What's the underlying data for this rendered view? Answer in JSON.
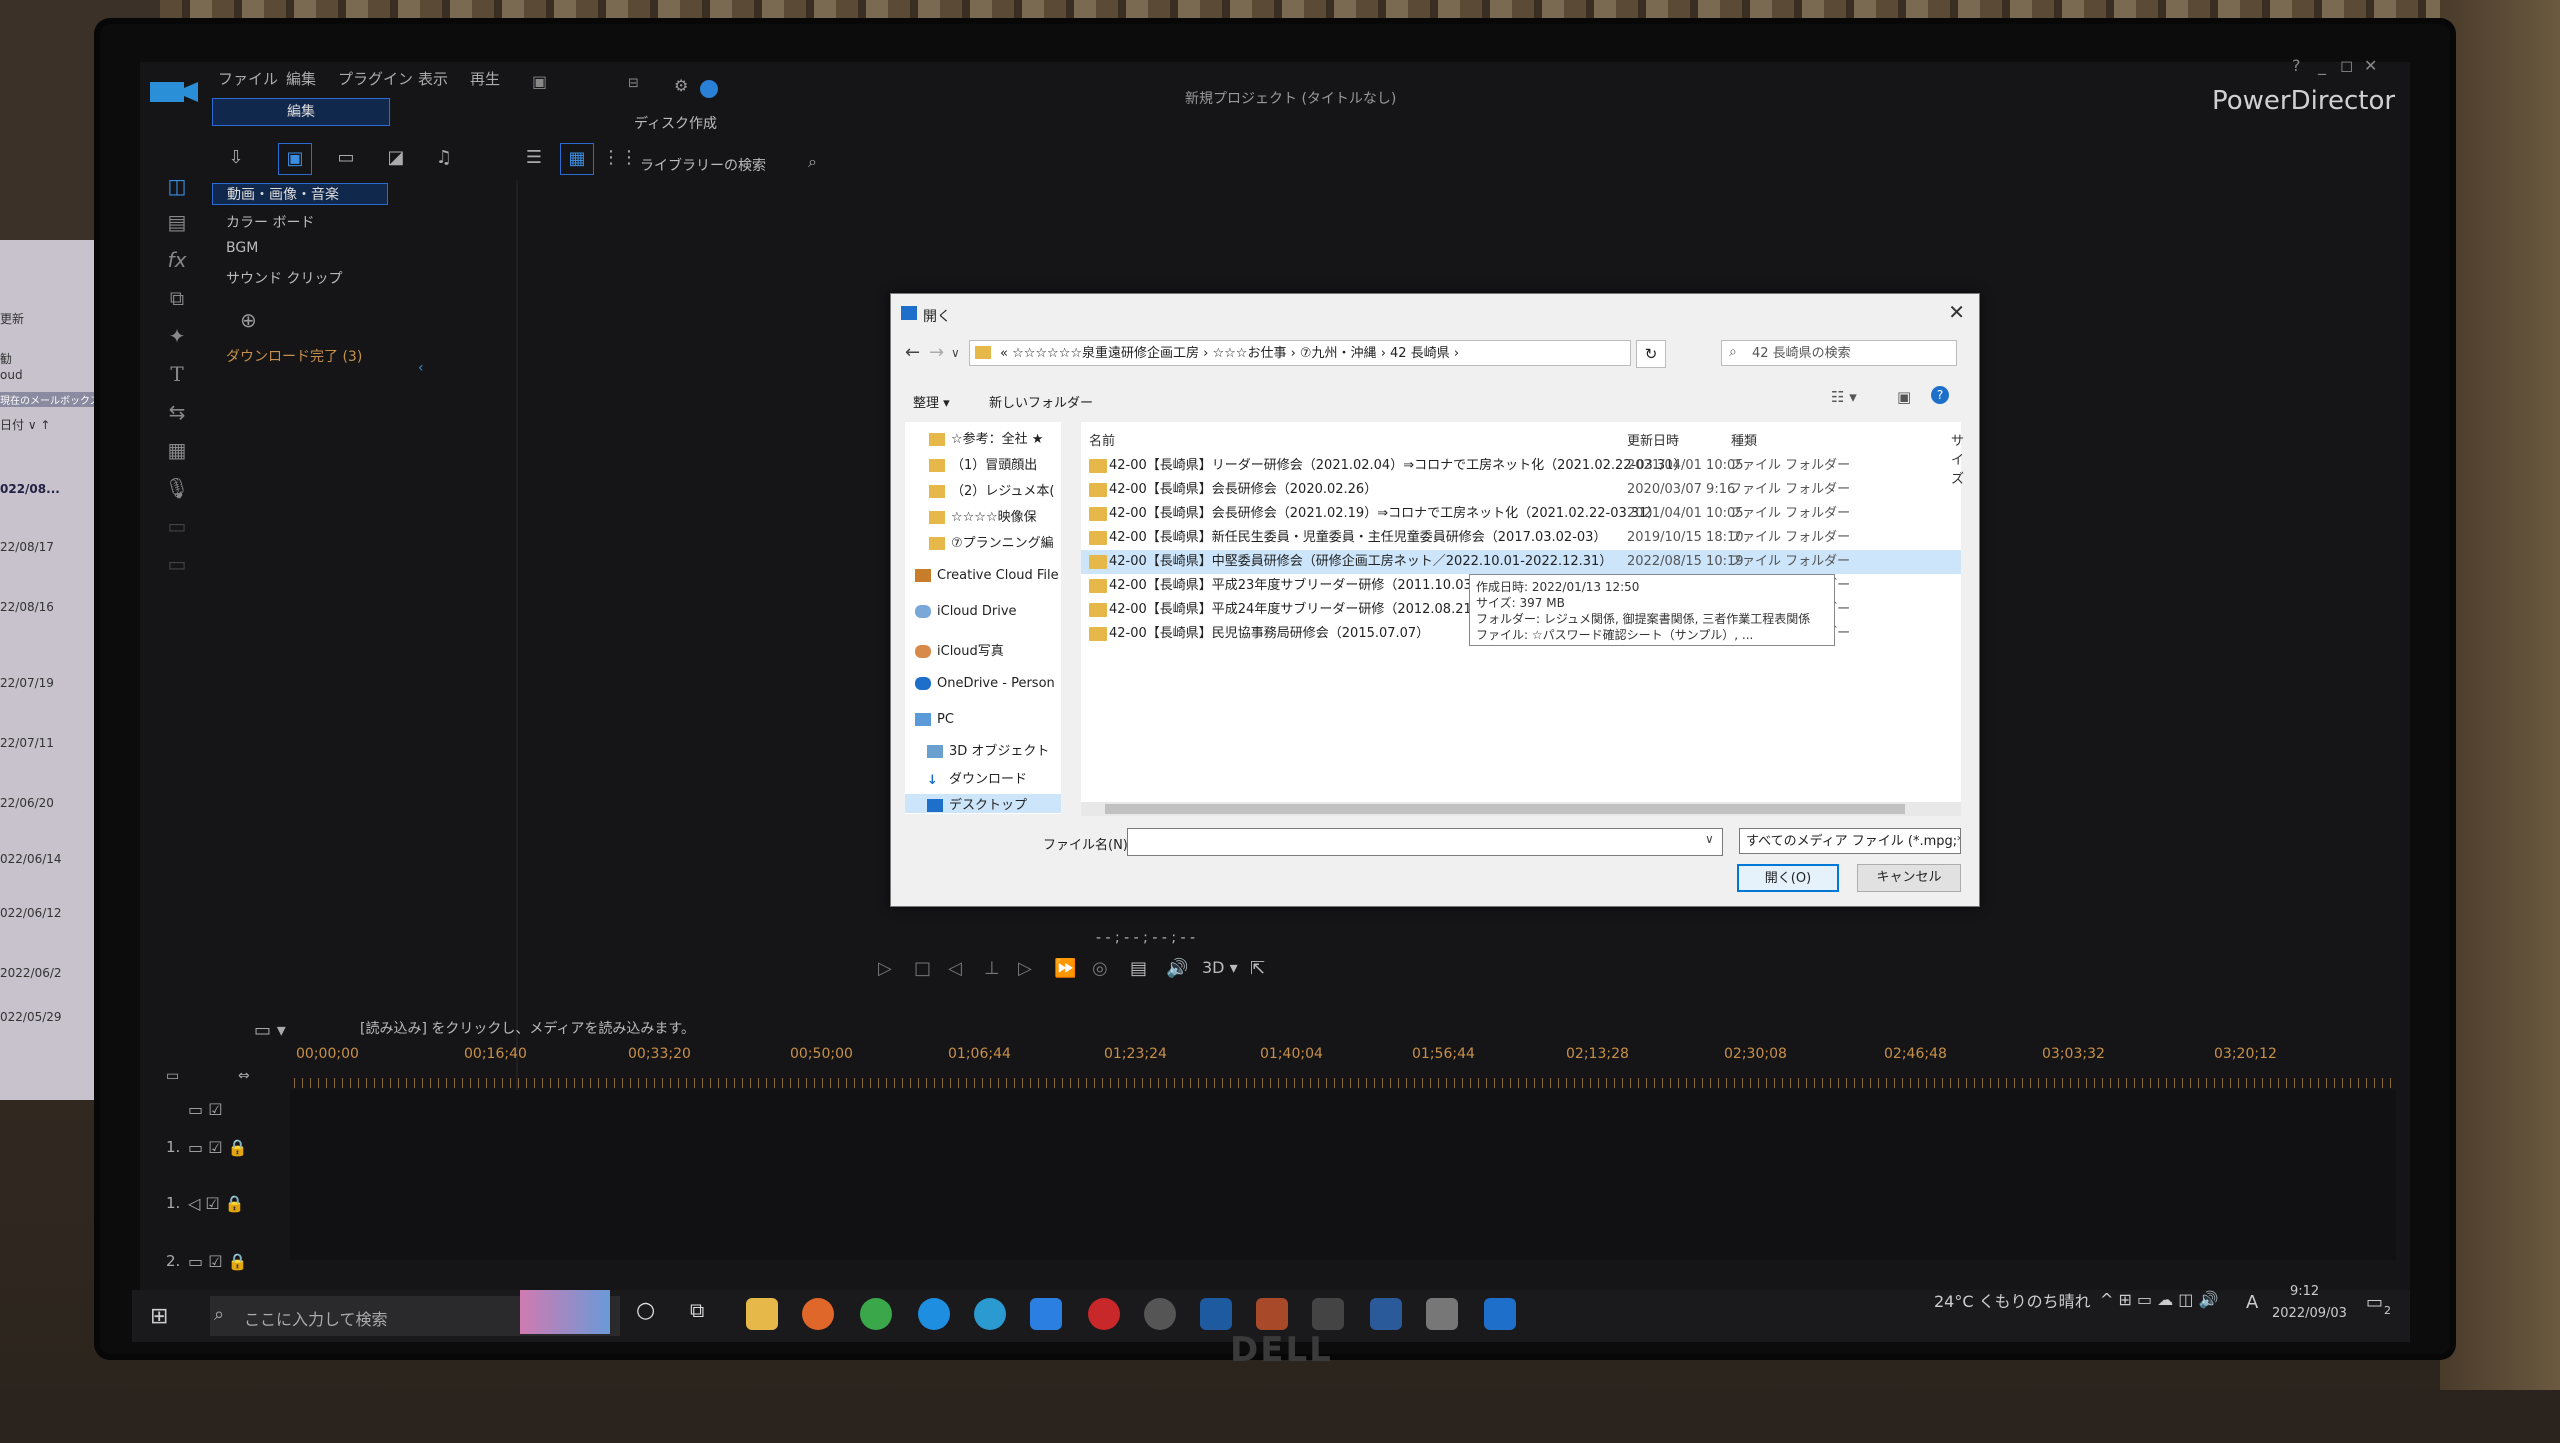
{
  "app": {
    "title": "新規プロジェクト (タイトルなし)",
    "brand": "PowerDirector",
    "menu": [
      "ファイル",
      "編集",
      "プラグイン",
      "表示",
      "再生"
    ],
    "mode_tab": "編集",
    "mode_tab_disk": "ディスク作成",
    "window_controls": [
      "?",
      "_",
      "◻",
      "✕"
    ]
  },
  "library": {
    "search_placeholder": "ライブラリーの検索",
    "categories": [
      "動画・画像・音楽",
      "カラー ボード",
      "BGM",
      "サウンド クリップ"
    ],
    "download_status": "ダウンロード完了 (3)"
  },
  "dialog": {
    "title": "開く",
    "breadcrumb": "« ☆☆☆☆☆☆泉重遠研修企画工房 › ☆☆☆お仕事 › ⑦九州・沖縄 › 42 長崎県 ›",
    "search_placeholder": "42 長崎県の検索",
    "organize": "整理 ▾",
    "new_folder": "新しいフォルダー",
    "nav_items": [
      "☆参考：全社 ★",
      "（1）冒頭顔出",
      "（2）レジュメ本(",
      "☆☆☆☆映像保",
      "⑦プランニング編",
      "Creative Cloud File",
      "iCloud Drive",
      "iCloud写真",
      "OneDrive - Person",
      "PC",
      "3D オブジェクト",
      "ダウンロード",
      "デスクトップ"
    ],
    "columns": [
      "名前",
      "更新日時",
      "種類",
      "サイズ"
    ],
    "files": [
      {
        "name": "42-00【長崎県】リーダー研修会（2021.02.04）⇒コロナで工房ネット化（2021.02.22-03.31）",
        "date": "2021/04/01 10:05",
        "type": "ファイル フォルダー"
      },
      {
        "name": "42-00【長崎県】会長研修会（2020.02.26）",
        "date": "2020/03/07 9:16",
        "type": "ファイル フォルダー"
      },
      {
        "name": "42-00【長崎県】会長研修会（2021.02.19）⇒コロナで工房ネット化（2021.02.22-03.31）",
        "date": "2021/04/01 10:05",
        "type": "ファイル フォルダー"
      },
      {
        "name": "42-00【長崎県】新任民生委員・児童委員・主任児童委員研修会（2017.03.02-03）",
        "date": "2019/10/15 18:10",
        "type": "ファイル フォルダー"
      },
      {
        "name": "42-00【長崎県】中堅委員研修会（研修企画工房ネット／2022.10.01-2022.12.31）",
        "date": "2022/08/15 10:19",
        "type": "ファイル フォルダー"
      },
      {
        "name": "42-00【長崎県】平成23年度サブリーダー研修（2011.10.03-04-0",
        "date": "",
        "type": "ファイル フォルダー"
      },
      {
        "name": "42-00【長崎県】平成24年度サブリーダー研修（2012.08.21-27-2",
        "date": "",
        "type": "ファイル フォルダー"
      },
      {
        "name": "42-00【長崎県】民児協事務局研修会（2015.07.07）",
        "date": "",
        "type": "ファイル フォルダー"
      }
    ],
    "tooltip": [
      "作成日時: 2022/01/13 12:50",
      "サイズ: 397 MB",
      "フォルダー: レジュメ関係, 御提案書関係, 三者作業工程表関係",
      "ファイル: ☆パスワード確認シート（サンプル）, ..."
    ],
    "filename_label": "ファイル名(N):",
    "filename_value": "",
    "filter": "すべてのメディア ファイル (*.mpg;*.n",
    "open_button": "開く(O)",
    "cancel_button": "キャンセル"
  },
  "preview": {
    "timecode": "- - ; - - ; - - ; - -",
    "three_d": "3D ▾"
  },
  "timeline": {
    "hint": "[読み込み] をクリックし、メディアを読み込みます。",
    "ticks": [
      "00;00;00",
      "00;16;40",
      "00;33;20",
      "00;50;00",
      "01;06;44",
      "01;23;24",
      "01;40;04",
      "01;56;44",
      "02;13;28",
      "02;30;08",
      "02;46;48",
      "03;03;32",
      "03;20;12"
    ],
    "tracks": [
      "1.",
      "1.",
      "2."
    ]
  },
  "taskbar": {
    "search_placeholder": "ここに入力して検索",
    "weather": "24°C くもりのち晴れ",
    "ime": "A",
    "time": "9:12",
    "date": "2022/09/03",
    "notifications": "2"
  },
  "laptop": {
    "rows": [
      "更新",
      "勧",
      "oud",
      "現在のメールボックス",
      "日付 ∨ ↑",
      "022/08...",
      "22/08/17",
      "22/08/16",
      "22/07/19",
      "22/07/11",
      "22/06/20",
      "022/06/14",
      "022/06/12",
      "2022/06/2",
      "022/05/29"
    ]
  },
  "monitor": {
    "logo": "DELL"
  },
  "colors": {
    "accent": "#2a6cd4",
    "timeline_ticks": "#c7904a",
    "folder": "#e6b84a",
    "selection": "#cce5fb"
  }
}
